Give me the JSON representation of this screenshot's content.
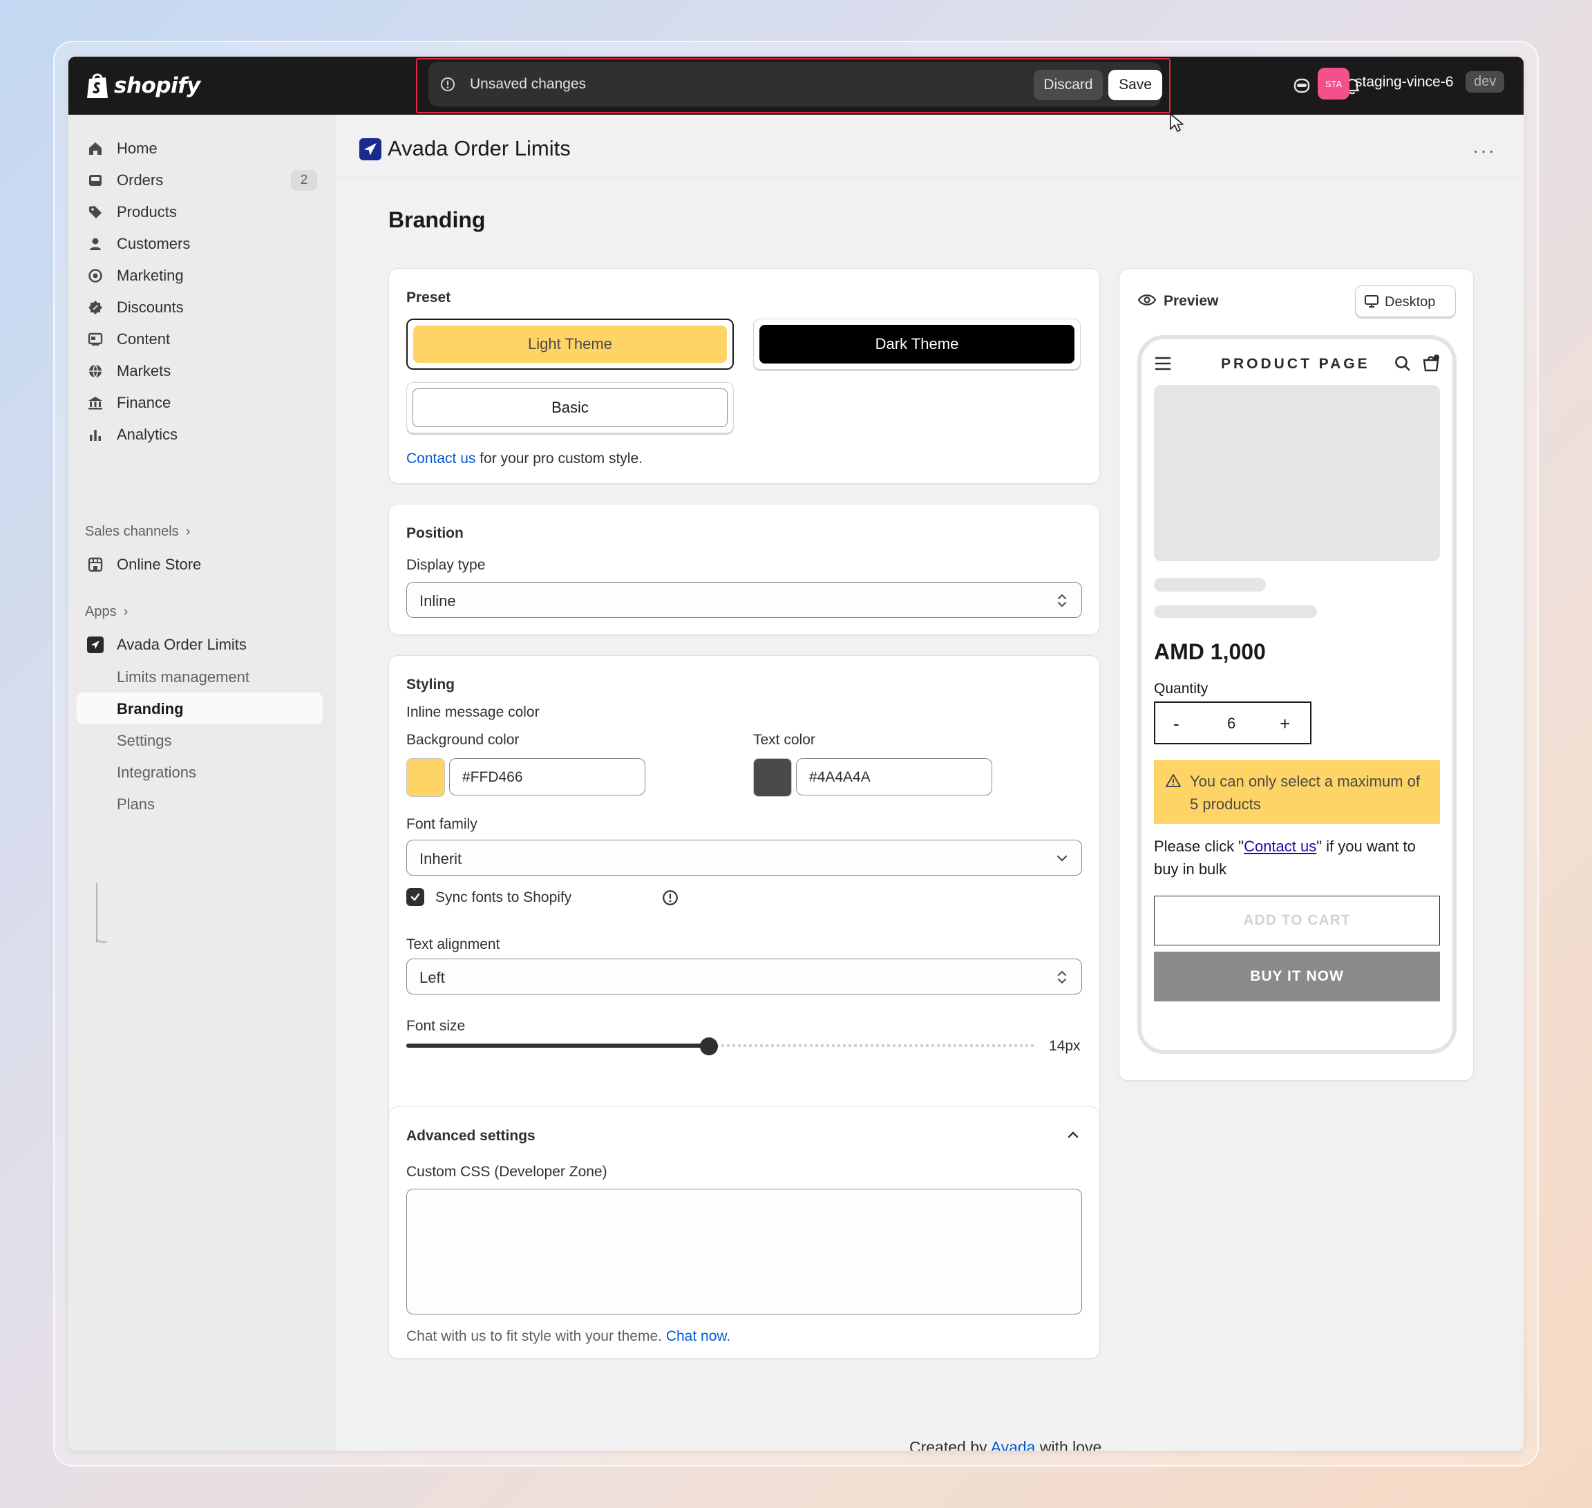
{
  "topbar": {
    "logo_text": "shopify",
    "unsaved_message": "Unsaved changes",
    "discard_label": "Discard",
    "save_label": "Save",
    "avatar_initials": "STA",
    "store_name": "staging-vince-6",
    "env_badge": "dev"
  },
  "sidebar": {
    "items": [
      {
        "label": "Home",
        "icon": "home-icon"
      },
      {
        "label": "Orders",
        "icon": "orders-icon",
        "count": "2"
      },
      {
        "label": "Products",
        "icon": "tag-icon"
      },
      {
        "label": "Customers",
        "icon": "person-icon"
      },
      {
        "label": "Marketing",
        "icon": "target-icon"
      },
      {
        "label": "Discounts",
        "icon": "discount-icon"
      },
      {
        "label": "Content",
        "icon": "content-icon"
      },
      {
        "label": "Markets",
        "icon": "globe-icon"
      },
      {
        "label": "Finance",
        "icon": "bank-icon"
      },
      {
        "label": "Analytics",
        "icon": "bar-chart-icon"
      }
    ],
    "sales_channels_label": "Sales channels",
    "online_store_label": "Online Store",
    "apps_label": "Apps",
    "app_name": "Avada Order Limits",
    "app_subitems": [
      "Limits management",
      "Branding",
      "Settings",
      "Integrations",
      "Plans"
    ],
    "active_subitem": "Branding"
  },
  "header": {
    "app_title": "Avada Order Limits",
    "more_label": "···"
  },
  "page": {
    "title": "Branding"
  },
  "preset": {
    "title": "Preset",
    "themes": [
      "Light Theme",
      "Dark Theme",
      "Basic"
    ],
    "selected": "Light Theme",
    "contact_link": "Contact us",
    "contact_rest": " for your pro custom style."
  },
  "position": {
    "title": "Position",
    "display_type_label": "Display type",
    "display_type_value": "Inline"
  },
  "styling": {
    "title": "Styling",
    "inline_message_color_label": "Inline message color",
    "background_color_label": "Background color",
    "background_color_value": "#FFD466",
    "text_color_label": "Text color",
    "text_color_value": "#4A4A4A",
    "font_family_label": "Font family",
    "font_family_value": "Inherit",
    "sync_fonts_label": "Sync fonts to Shopify",
    "sync_fonts_checked": true,
    "text_alignment_label": "Text alignment",
    "text_alignment_value": "Left",
    "font_size_label": "Font size",
    "font_size_value": "14px",
    "font_size_level": 0.48
  },
  "advanced": {
    "title": "Advanced settings",
    "custom_css_label": "Custom CSS (Developer Zone)",
    "custom_css_value": "",
    "help_text": "Chat with us to fit style with your theme. ",
    "chat_link": "Chat now."
  },
  "preview": {
    "title": "Preview",
    "device_label": "Desktop",
    "product_page_title": "PRODUCT PAGE",
    "price": "AMD 1,000",
    "quantity_label": "Quantity",
    "qty_minus": "-",
    "quantity_value": "6",
    "qty_plus": "+",
    "warning_text": "You can only select a maximum of 5 products",
    "contact_prefix": "Please click \"",
    "contact_link": "Contact us",
    "contact_suffix": "\" if you want to buy in bulk",
    "add_to_cart_label": "ADD TO CART",
    "buy_now_label": "BUY IT NOW"
  },
  "footer": {
    "prefix": "Created by ",
    "brand_link": "Avada",
    "suffix": " with love"
  },
  "colors": {
    "light_theme_bg": "#FFD466",
    "dark_theme_bg": "#000000",
    "topbar_bg": "#1A1A1A",
    "link": "#005BD3",
    "avatar": "#F4508C",
    "save_bar_outline": "#E2283F"
  }
}
